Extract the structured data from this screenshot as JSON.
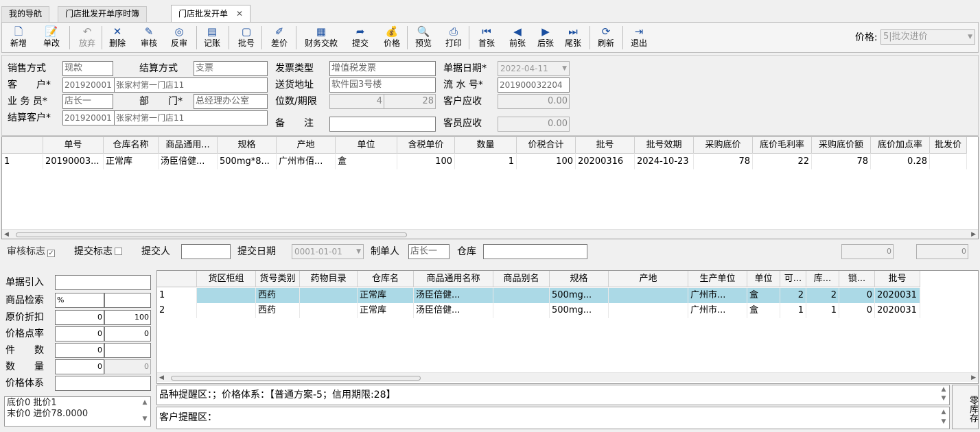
{
  "tabs": [
    {
      "label": "我的导航"
    },
    {
      "label": "门店批发开单序时簿"
    },
    {
      "label": "门店批发开单",
      "close": "✕"
    }
  ],
  "toolbar": {
    "buttons": [
      {
        "label": "新增",
        "icon": "new-doc-icon",
        "glyph": "🗋"
      },
      {
        "label": "单改",
        "icon": "edit-doc-icon",
        "glyph": "📝"
      },
      {
        "label": "放弃",
        "icon": "undo-icon",
        "glyph": "↶"
      },
      {
        "label": "删除",
        "icon": "delete-icon",
        "glyph": "✕"
      },
      {
        "label": "审核",
        "icon": "audit-icon",
        "glyph": "✎"
      },
      {
        "label": "反审",
        "icon": "unaudit-icon",
        "glyph": "◎"
      },
      {
        "label": "记账",
        "icon": "ledger-icon",
        "glyph": "▤"
      },
      {
        "label": "批号",
        "icon": "batch-icon",
        "glyph": "▢"
      },
      {
        "label": "差价",
        "icon": "price-diff-icon",
        "glyph": "✐"
      },
      {
        "label": "财务交款",
        "icon": "finance-icon",
        "glyph": "▦"
      },
      {
        "label": "提交",
        "icon": "submit-icon",
        "glyph": "➦"
      },
      {
        "label": "价格",
        "icon": "money-bag-icon",
        "glyph": "💰"
      },
      {
        "label": "预览",
        "icon": "preview-icon",
        "glyph": "🔍"
      },
      {
        "label": "打印",
        "icon": "print-icon",
        "glyph": "⎙"
      },
      {
        "label": "首张",
        "icon": "first-icon",
        "glyph": "⏮"
      },
      {
        "label": "前张",
        "icon": "prev-icon",
        "glyph": "◀"
      },
      {
        "label": "后张",
        "icon": "next-icon",
        "glyph": "▶"
      },
      {
        "label": "尾张",
        "icon": "last-icon",
        "glyph": "⏭"
      },
      {
        "label": "刷新",
        "icon": "refresh-icon",
        "glyph": "⟳"
      },
      {
        "label": "退出",
        "icon": "exit-icon",
        "glyph": "⇥"
      }
    ],
    "price_label": "价格:",
    "price_value": "5|批次进价"
  },
  "form": {
    "sale_mode_label": "销售方式",
    "sale_mode": "现款",
    "settle_mode_label": "结算方式",
    "settle_mode": "支票",
    "invoice_type_label": "发票类型",
    "invoice_type": "增值税发票",
    "doc_date_label": "单据日期*",
    "doc_date": "2022-04-11",
    "customer_label": "客　　户*",
    "customer_code": "201920001",
    "customer_name": "张家村第一门店11",
    "delivery_label": "送货地址",
    "delivery": "软件园3号楼",
    "serial_label": "流 水 号*",
    "serial": "201900032204",
    "salesman_label": "业 务 员*",
    "salesman": "店长一",
    "dept_label": "部　　门*",
    "dept": "总经理办公室",
    "digits_label": "位数/期限",
    "digits": "4",
    "term": "28",
    "cust_recv_label": "客户应收",
    "cust_recv": "0.00",
    "settle_cust_label": "结算客户*",
    "settle_cust_code": "201920001",
    "settle_cust_name": "张家村第一门店11",
    "remark_label": "备　　注",
    "remark": "",
    "staff_recv_label": "客员应收",
    "staff_recv": "0.00"
  },
  "detail": {
    "headers": [
      "",
      "单号",
      "仓库名称",
      "商品通用...",
      "规格",
      "产地",
      "单位",
      "含税单价",
      "数量",
      "价税合计",
      "批号",
      "批号效期",
      "采购底价",
      "底价毛利率",
      "采购底价额",
      "底价加点率",
      "批发价"
    ],
    "rows": [
      [
        "1",
        "20190003...",
        "正常库",
        "汤臣倍健...",
        "500mg*8...",
        "广州市佰...",
        "盒",
        "100",
        "1",
        "100",
        "20200316",
        "2024-10-23",
        "78",
        "22",
        "78",
        "0.28",
        ""
      ]
    ]
  },
  "status": {
    "audit_label": "审核标志",
    "submit_flag_label": "提交标志",
    "submitter_label": "提交人",
    "submitter": "",
    "submit_date_label": "提交日期",
    "submit_date": "0001-01-01",
    "creator_label": "制单人",
    "creator": "店长一",
    "warehouse_label": "仓库",
    "warehouse": "",
    "num1": "0",
    "num2": "0"
  },
  "left_panel": {
    "doc_import_label": "单据引入",
    "doc_import": "",
    "search_label": "商品检索",
    "search_value": "%",
    "search_extra": "",
    "discount_label": "原价折扣",
    "discount_a": "0",
    "discount_b": "100",
    "rate_label": "价格点率",
    "rate_a": "0",
    "rate_b": "0",
    "pieces_label": "件　　数",
    "pieces_a": "0",
    "pieces_b": "",
    "qty_label": "数　　量",
    "qty_a": "0",
    "qty_b": "0",
    "price_sys_label": "价格体系",
    "price_sys": "",
    "memo_line1": "底价0 批价1",
    "memo_line2": "末价0 进价78.0000"
  },
  "stock": {
    "headers": [
      "",
      "货区柜组",
      "货号类别",
      "药物目录",
      "仓库名",
      "商品通用名称",
      "商品别名",
      "规格",
      "产地",
      "生产单位",
      "单位",
      "可...",
      "库...",
      "锁...",
      "批号"
    ],
    "rows": [
      [
        "1",
        "",
        "西药",
        "",
        "正常库",
        "汤臣倍健...",
        "",
        "500mg...",
        "",
        "广州市...",
        "盒",
        "2",
        "2",
        "0",
        "2020031"
      ],
      [
        "2",
        "",
        "西药",
        "",
        "正常库",
        "汤臣倍健...",
        "",
        "500mg...",
        "",
        "广州市...",
        "盒",
        "1",
        "1",
        "0",
        "2020031"
      ]
    ]
  },
  "reminders": {
    "variety": "品种提醒区：；价格体系：【普通方案-5；信用期限:28】",
    "customer": "客户提醒区：",
    "zero_stock": "零库存"
  },
  "colors": {
    "selected_row": "#abd9e6",
    "accent": "#1a4fa0"
  }
}
